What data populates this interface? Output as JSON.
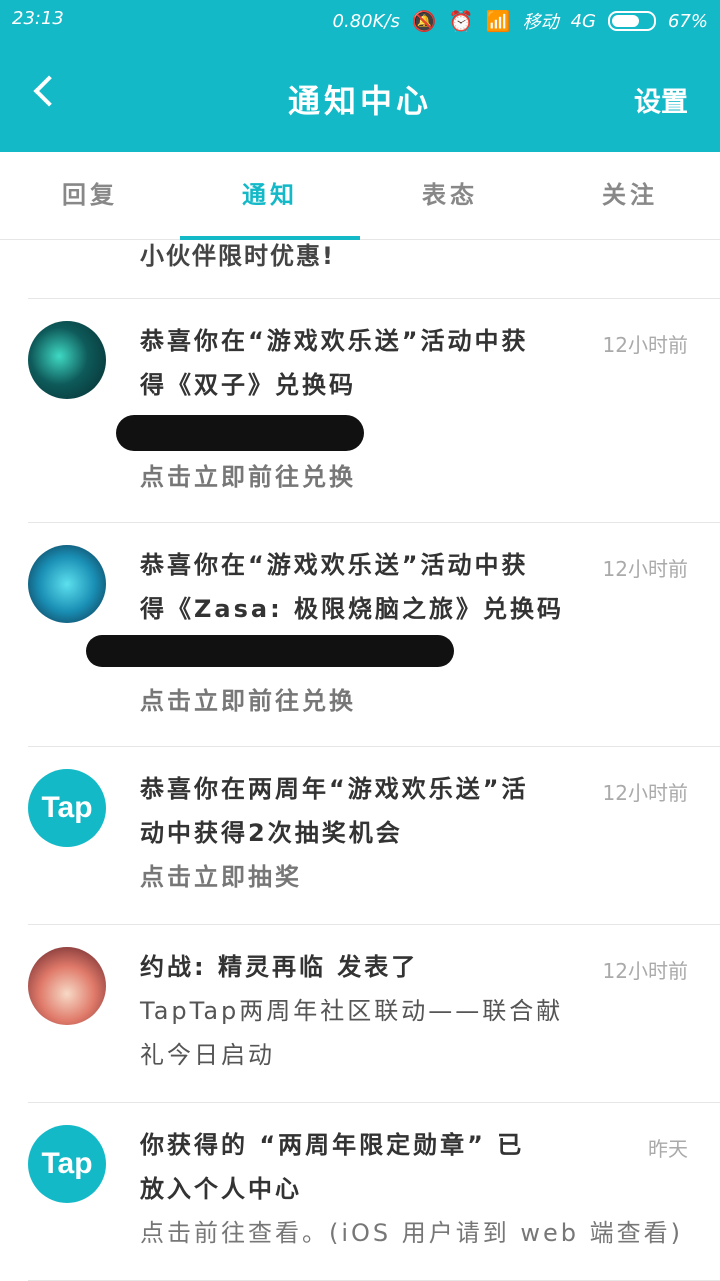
{
  "status": {
    "time": "23:13",
    "speed": "0.80K/s",
    "carrier": "移动",
    "network": "4G",
    "battery": "67%"
  },
  "header": {
    "title": "通知中心",
    "settings": "设置"
  },
  "tabs": [
    "回复",
    "通知",
    "表态",
    "关注"
  ],
  "partial_text": "小伙伴限时优惠!",
  "items": [
    {
      "msg_1": "恭喜你在“游戏欢乐送”活动中获",
      "msg_2": "得《双子》兑换码",
      "action": "点击立即前往兑换",
      "time": "12小时前",
      "avatar": "gemini-game-avatar"
    },
    {
      "msg_1": "恭喜你在“游戏欢乐送”活动中获",
      "msg_2": "得《Zasa: 极限烧脑之旅》兑换码",
      "action": "点击立即前往兑换",
      "time": "12小时前",
      "avatar": "cube-game-avatar"
    },
    {
      "msg_1": "恭喜你在两周年“游戏欢乐送”活",
      "msg_2": "动中获得2次抽奖机会",
      "action": "点击立即抽奖",
      "time": "12小时前",
      "avatar": "Tap"
    },
    {
      "msg_1": "约战: 精灵再临 发表了",
      "msg_2": "TapTap两周年社区联动——联合献",
      "msg_3": "礼今日启动",
      "time": "12小时前",
      "avatar": "anime-user-avatar"
    },
    {
      "msg_1": "你获得的 “两周年限定勋章” 已",
      "msg_2": "放入个人中心",
      "action": "点击前往查看。(iOS 用户请到 web 端查看)",
      "time": "昨天",
      "avatar": "Tap"
    }
  ]
}
